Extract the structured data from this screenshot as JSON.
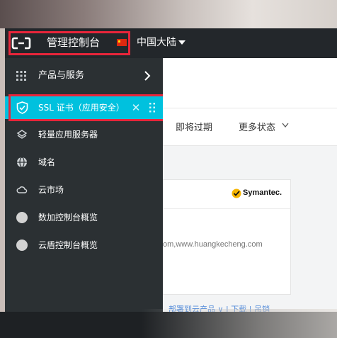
{
  "header": {
    "brand_label": "管理控制台",
    "region_label": "中国大陆"
  },
  "sidebar": {
    "products_label": "产品与服务",
    "active_item_label": "SSL 证书（应用安全）",
    "items": [
      {
        "label": "轻量应用服务器",
        "icon": "layers-icon"
      },
      {
        "label": "域名",
        "icon": "globe-icon"
      },
      {
        "label": "云市场",
        "icon": "cloud-market-icon"
      },
      {
        "label": "数加控制台概览",
        "icon": "circle-icon"
      },
      {
        "label": "云盾控制台概览",
        "icon": "circle-icon"
      }
    ]
  },
  "main": {
    "tab_expiring": "即将过期",
    "tab_more_status": "更多状态",
    "card": {
      "brand": "Symantec.",
      "domains_partial": "om,www.huangkecheng.com"
    },
    "bottom_partial_links": "部署到云产品 ∨ | 下载 | 吊销"
  },
  "colors": {
    "highlight_box": "#e8253a",
    "active_item_bg": "#00c1de",
    "sidebar_bg": "#2b3033",
    "topbar_bg": "#23272b"
  }
}
